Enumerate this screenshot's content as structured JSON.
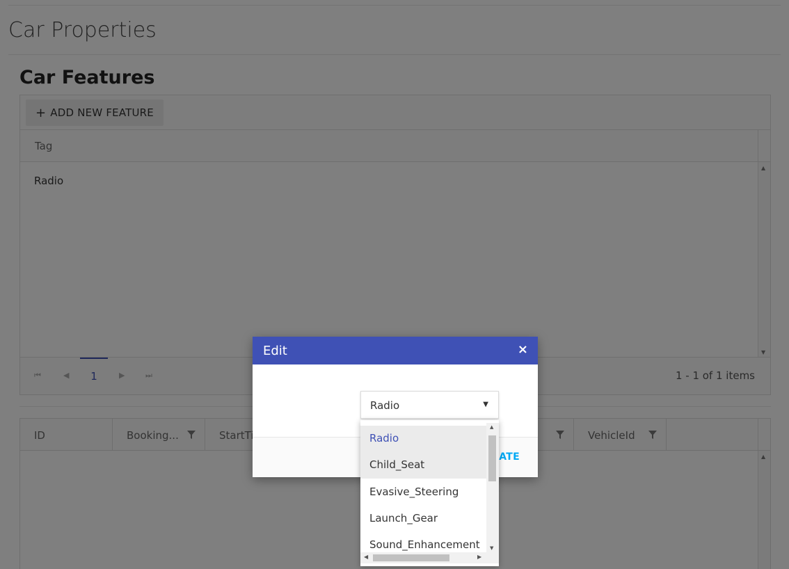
{
  "page": {
    "title": "Car Properties"
  },
  "features": {
    "section_title": "Car Features",
    "add_button_label": "ADD NEW FEATURE",
    "column_header": "Tag",
    "rows": [
      {
        "tag": "Radio"
      }
    ],
    "pager": {
      "current_page": "1",
      "info": "1 - 1 of 1 items"
    }
  },
  "bookings": {
    "columns": [
      {
        "label": "ID"
      },
      {
        "label": "Booking..."
      },
      {
        "label": "StartTi"
      },
      {
        "label": "VehicleId"
      }
    ]
  },
  "dialog": {
    "title": "Edit",
    "close_glyph": "×",
    "update_label_visible": "DATE",
    "dropdown": {
      "selected": "Radio",
      "options": [
        "Radio",
        "Child_Seat",
        "Evasive_Steering",
        "Launch_Gear",
        "Sound_Enhancement"
      ]
    }
  },
  "icons": {
    "plus": "plus-icon",
    "filter": "filter-icon",
    "caret": "caret-down-icon",
    "close": "close-icon"
  },
  "colors": {
    "accent": "#3f51b5",
    "update_text": "#03a9f4"
  }
}
